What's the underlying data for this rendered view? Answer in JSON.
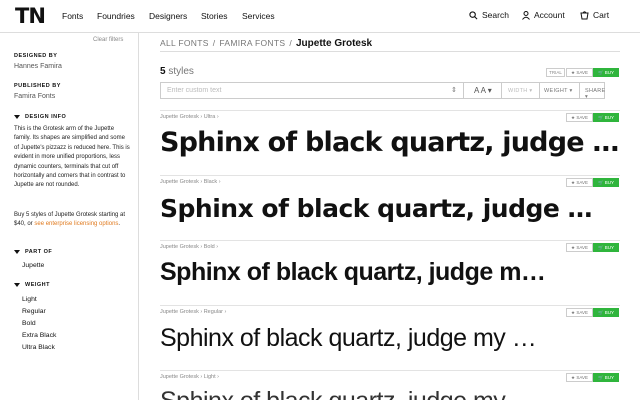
{
  "nav": {
    "logo": "TN",
    "items": [
      "Fonts",
      "Foundries",
      "Designers",
      "Stories",
      "Services"
    ],
    "search": "Search",
    "account": "Account",
    "cart": "Cart"
  },
  "sidebar": {
    "clear_filters": "Clear filters",
    "designed_by_label": "DESIGNED BY",
    "designed_by": "Hannes Famira",
    "published_by_label": "PUBLISHED BY",
    "published_by": "Famira Fonts",
    "design_info_label": "DESIGN INFO",
    "design_info": "This is the Grotesk arm of the Jupette family. Its shapes are simplified and some of Jupette's pizzazz is reduced here. This is evident in more unified proportions, less dynamic counters, terminals that cut off horizontally and corners that in contrast to Jupette are not rounded.",
    "buy_note_prefix": "Buy 5 styles of Jupette Grotesk starting at $40, or ",
    "buy_note_link": "see enterprise licensing options",
    "buy_note_suffix": ".",
    "part_of_label": "PART OF",
    "part_of": "Jupette",
    "weight_label": "WEIGHT",
    "weights": [
      "Light",
      "Regular",
      "Bold",
      "Extra Black",
      "Ultra Black"
    ]
  },
  "breadcrumb": {
    "all_fonts": "ALL FONTS",
    "sep1": "/",
    "foundry": "FAMIRA FONTS",
    "sep2": "/",
    "current": "Jupette Grotesk"
  },
  "header": {
    "count": "5",
    "count_suffix": "styles",
    "trial": "TRIAL",
    "save": "SAVE",
    "buy": "BUY"
  },
  "toolbar": {
    "placeholder": "Enter custom text",
    "size": "A A",
    "width": "WIDTH",
    "weight": "WEIGHT",
    "share": "SHARE"
  },
  "styles": [
    {
      "meta": "Jupette Grotesk  ›  Ultra  ›",
      "sample": "Sphinx of black quartz, judge …",
      "weight": 900,
      "size": 27
    },
    {
      "meta": "Jupette Grotesk  ›  Black  ›",
      "sample": "Sphinx of black quartz, judge …",
      "weight": 800,
      "size": 25
    },
    {
      "meta": "Jupette Grotesk  ›  Bold  ›",
      "sample": "Sphinx of black quartz, judge m…",
      "weight": 700,
      "size": 25
    },
    {
      "meta": "Jupette Grotesk  ›  Regular  ›",
      "sample": "Sphinx of black quartz, judge my …",
      "weight": 400,
      "size": 25
    },
    {
      "meta": "Jupette Grotesk  ›  Light  ›",
      "sample": "Sphinx of black quartz, judge my …",
      "weight": 300,
      "size": 25
    }
  ],
  "colors": {
    "buy": "#2fb53c",
    "link": "#e07a1e"
  }
}
